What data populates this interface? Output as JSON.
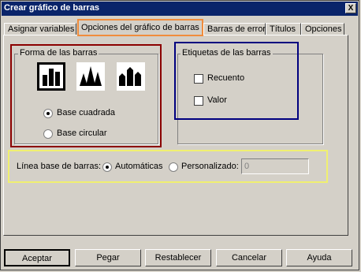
{
  "window": {
    "title": "Crear gráfico de barras",
    "close": "X"
  },
  "tabs": [
    {
      "label": "Asignar variables",
      "active": false
    },
    {
      "label": "Opciones del gráfico de barras",
      "active": true
    },
    {
      "label": "Barras de error",
      "active": false
    },
    {
      "label": "Títulos",
      "active": false
    },
    {
      "label": "Opciones",
      "active": false
    }
  ],
  "shape_group": {
    "title": "Forma de las barras",
    "bar_styles": [
      {
        "icon": "square-bars-icon",
        "selected": true
      },
      {
        "icon": "spike-bars-icon",
        "selected": false
      },
      {
        "icon": "house-bars-icon",
        "selected": false
      }
    ],
    "base_square": {
      "label": "Base cuadrada",
      "checked": true
    },
    "base_circular": {
      "label": "Base circular",
      "checked": false
    }
  },
  "labels_group": {
    "title": "Etiquetas de las barras",
    "count": {
      "label": "Recuento",
      "checked": false
    },
    "value": {
      "label": "Valor",
      "checked": false
    }
  },
  "baseline": {
    "label": "Línea base de barras:",
    "automatic": {
      "label": "Automáticas",
      "checked": true
    },
    "custom": {
      "label": "Personalizado:",
      "checked": false
    },
    "custom_value": "0"
  },
  "buttons": {
    "accept": "Aceptar",
    "paste": "Pegar",
    "reset": "Restablecer",
    "cancel": "Cancelar",
    "help": "Ayuda"
  },
  "colors": {
    "titlebar": "#0a246a",
    "face": "#d4d0c8",
    "annotation_orange": "#f08c3c",
    "annotation_maroon": "#8b0000",
    "annotation_navy": "#00007f",
    "annotation_yellow": "#f0f070"
  }
}
